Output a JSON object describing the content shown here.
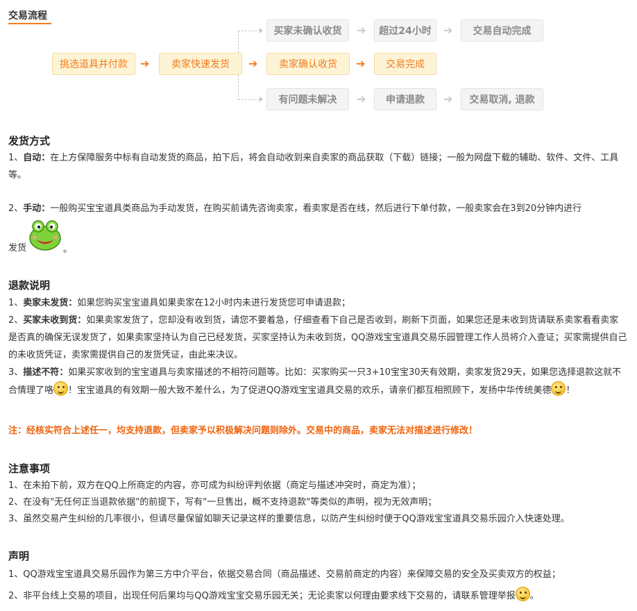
{
  "header": {
    "title": "交易流程"
  },
  "flow": {
    "main": [
      "挑选道具并付款",
      "卖家快速发货",
      "卖家确认收货",
      "交易完成"
    ],
    "top": [
      "买家未确认收货",
      "超过24小时",
      "交易自动完成"
    ],
    "bottom": [
      "有问题未解决",
      "申请退款",
      "交易取消, 退款"
    ],
    "arrow": "➔"
  },
  "shipping": {
    "title": "发货方式",
    "auto_prefix": "1、",
    "auto_label": "自动：",
    "auto_text": "在上方保障服务中标有自动发货的商品，拍下后，将会自动收到来自卖家的商品获取（下载）链接；一般为网盘下载的辅助、软件、文件、工具等。",
    "manual_prefix": "2、",
    "manual_label": "手动：",
    "manual_text": "一般购买宝宝道具类商品为手动发货，在购买前请先咨询卖家，看卖家是否在线，然后进行下单付款，一般卖家会在3到20分钟内进行",
    "manual_tail_a": "发货",
    "manual_tail_b": "。"
  },
  "refund": {
    "title": "退款说明",
    "item1_prefix": "1、",
    "item1_label": "卖家未发货：",
    "item1_text": "如果您购买宝宝道具如果卖家在12小时内未进行发货您可申请退款；",
    "item2_prefix": "2、",
    "item2_label": "买家未收到货：",
    "item2_text": "如果卖家发货了，您却没有收到货，请您不要着急，仔细查看下自己是否收到，刷新下页面，如果您还是未收到货请联系卖家看看卖家是否真的确保无误发货了，如果卖家坚持认为自己已经发货，买家坚持认为未收到货，QQ游戏宝宝道具交易乐园管理工作人员将介入查证；买家需提供自己的未收货凭证，卖家需提供自己的发货凭证，由此来决议。",
    "item3_prefix": "3、",
    "item3_label": "描述不符：",
    "item3_text_a": "如果买家收到的宝宝道具与卖家描述的不相符问题等。比如：买家购买一只3+10宝宝30天有效期，卖家发货29天，如果您选择退款这就不合情理了咯",
    "item3_text_b": "！宝宝道具的有效期一般大致不差什么，为了促进QQ游戏宝宝道具交易的欢乐，请亲们都互相照顾下，发扬中华传统美德",
    "item3_text_c": "！",
    "note": "注：经核实符合上述任一，均支持退款，但卖家予以积极解决问题则除外。交易中的商品，卖家无法对描述进行修改！"
  },
  "notice": {
    "title": "注意事项",
    "items": [
      "1、在未拍下前，双方在QQ上所商定的内容，亦可成为纠纷评判依据（商定与描述冲突时，商定为准）；",
      "2、在没有\"无任何正当退款依据\"的前提下，写有\"一旦售出，概不支持退款\"等类似的声明，视为无效声明；",
      "3、虽然交易产生纠纷的几率很小，但请尽量保留如聊天记录这样的重要信息，以防产生纠纷时便于QQ游戏宝宝道具交易乐园介入快速处理。"
    ]
  },
  "statement": {
    "title": "声明",
    "item1": "1、QQ游戏宝宝道具交易乐园作为第三方中介平台，依据交易合同（商品描述、交易前商定的内容）来保障交易的安全及买卖双方的权益；",
    "item2_text": "2、非平台线上交易的项目，出现任何后果均与QQ游戏宝宝交易乐园无关；无论卖家以何理由要求线下交易的，请联系管理举报",
    "item2_tail": "。"
  },
  "colors": {
    "accent": "#f07c1d",
    "note": "#f0630d"
  },
  "icons": [
    "arrow-right-icon",
    "frog-emoticon-icon",
    "smiley-emoticon-icon"
  ]
}
